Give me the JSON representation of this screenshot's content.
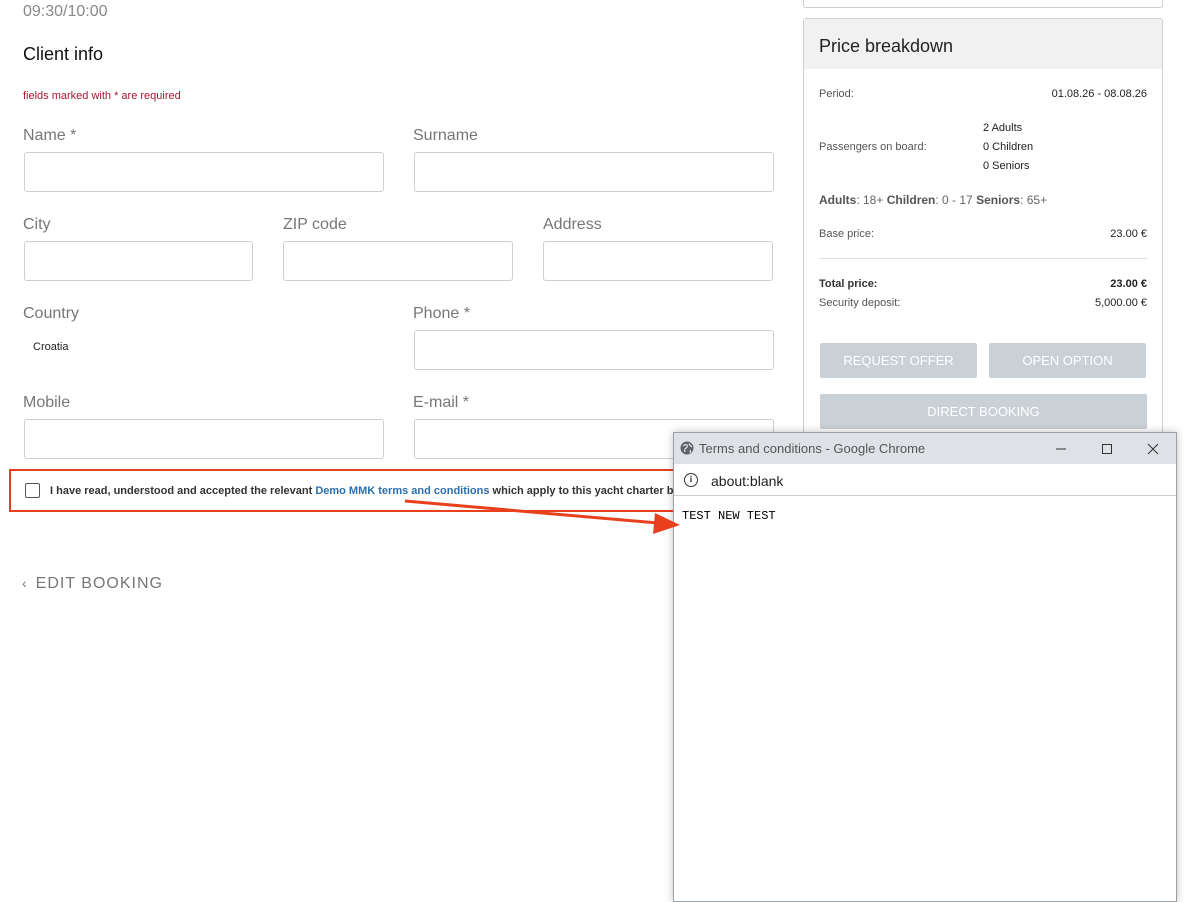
{
  "header": {
    "time": "09:30/10:00"
  },
  "client_info": {
    "title": "Client info",
    "required_note": "fields marked with * are required",
    "fields": {
      "name": {
        "label": "Name *",
        "value": ""
      },
      "surname": {
        "label": "Surname",
        "value": ""
      },
      "city": {
        "label": "City",
        "value": ""
      },
      "zip": {
        "label": "ZIP code",
        "value": ""
      },
      "address": {
        "label": "Address",
        "value": ""
      },
      "country": {
        "label": "Country",
        "value": "Croatia"
      },
      "phone": {
        "label": "Phone *",
        "value": ""
      },
      "mobile": {
        "label": "Mobile",
        "value": ""
      },
      "email": {
        "label": "E-mail *",
        "value": ""
      }
    },
    "terms": {
      "prefix": "I have read, understood and accepted the relevant ",
      "link": "Demo MMK terms and conditions",
      "suffix": " which apply to this yacht charter booking."
    },
    "edit_booking": "EDIT BOOKING"
  },
  "price_breakdown": {
    "title": "Price breakdown",
    "period_label": "Period:",
    "period_value": "01.08.26 - 08.08.26",
    "passengers_label": "Passengers on board:",
    "passengers": [
      "2 Adults",
      "0 Children",
      "0 Seniors"
    ],
    "ages": {
      "adults_label": "Adults",
      "adults_value": ": 18+ ",
      "children_label": "Children",
      "children_value": ": 0 - 17 ",
      "seniors_label": "Seniors",
      "seniors_value": ": 65+"
    },
    "base_price_label": "Base price:",
    "base_price_value": "23.00 €",
    "total_price_label": "Total price:",
    "total_price_value": "23.00 €",
    "deposit_label": "Security deposit:",
    "deposit_value": "5,000.00 €",
    "buttons": {
      "request_offer": "REQUEST OFFER",
      "open_option": "OPEN OPTION",
      "direct_booking": "DIRECT BOOKING"
    },
    "button_color": "#c9d0d6"
  },
  "popup": {
    "title": "Terms and conditions - Google Chrome",
    "url": "about:blank",
    "body": "TEST NEW TEST"
  },
  "annotation": {
    "color": "#e8401c"
  }
}
